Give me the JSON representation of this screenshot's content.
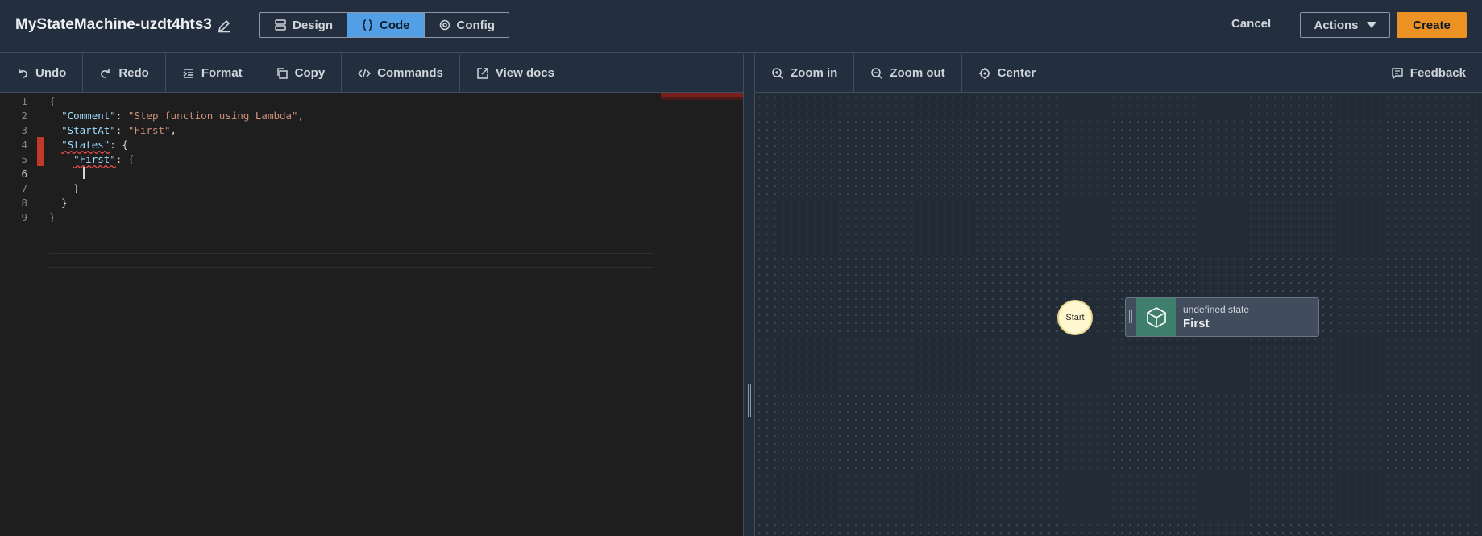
{
  "header": {
    "state_machine_name": "MyStateMachine-uzdt4hts3",
    "tabs": [
      {
        "label": "Design",
        "icon": "design-icon",
        "active": false
      },
      {
        "label": "Code",
        "icon": "code-braces-icon",
        "active": true
      },
      {
        "label": "Config",
        "icon": "gear-icon",
        "active": false
      }
    ],
    "cancel_label": "Cancel",
    "actions_label": "Actions",
    "create_label": "Create"
  },
  "editor_toolbar": {
    "undo": "Undo",
    "redo": "Redo",
    "format": "Format",
    "copy": "Copy",
    "commands": "Commands",
    "view_docs": "View docs"
  },
  "canvas_toolbar": {
    "zoom_in": "Zoom in",
    "zoom_out": "Zoom out",
    "center": "Center",
    "feedback": "Feedback"
  },
  "editor": {
    "line_numbers": [
      "1",
      "2",
      "3",
      "4",
      "5",
      "6",
      "7",
      "8",
      "9"
    ],
    "current_line": 6,
    "error_lines": [
      4,
      5
    ]
  },
  "graph": {
    "start_label": "Start",
    "state_type": "undefined state",
    "state_name": "First"
  },
  "colors": {
    "accent_active": "#539fe5",
    "create_button": "#ec9124",
    "error_marker": "#c2382a",
    "state_icon_bg": "#3f7f6c",
    "start_node": "#fff7cf"
  }
}
